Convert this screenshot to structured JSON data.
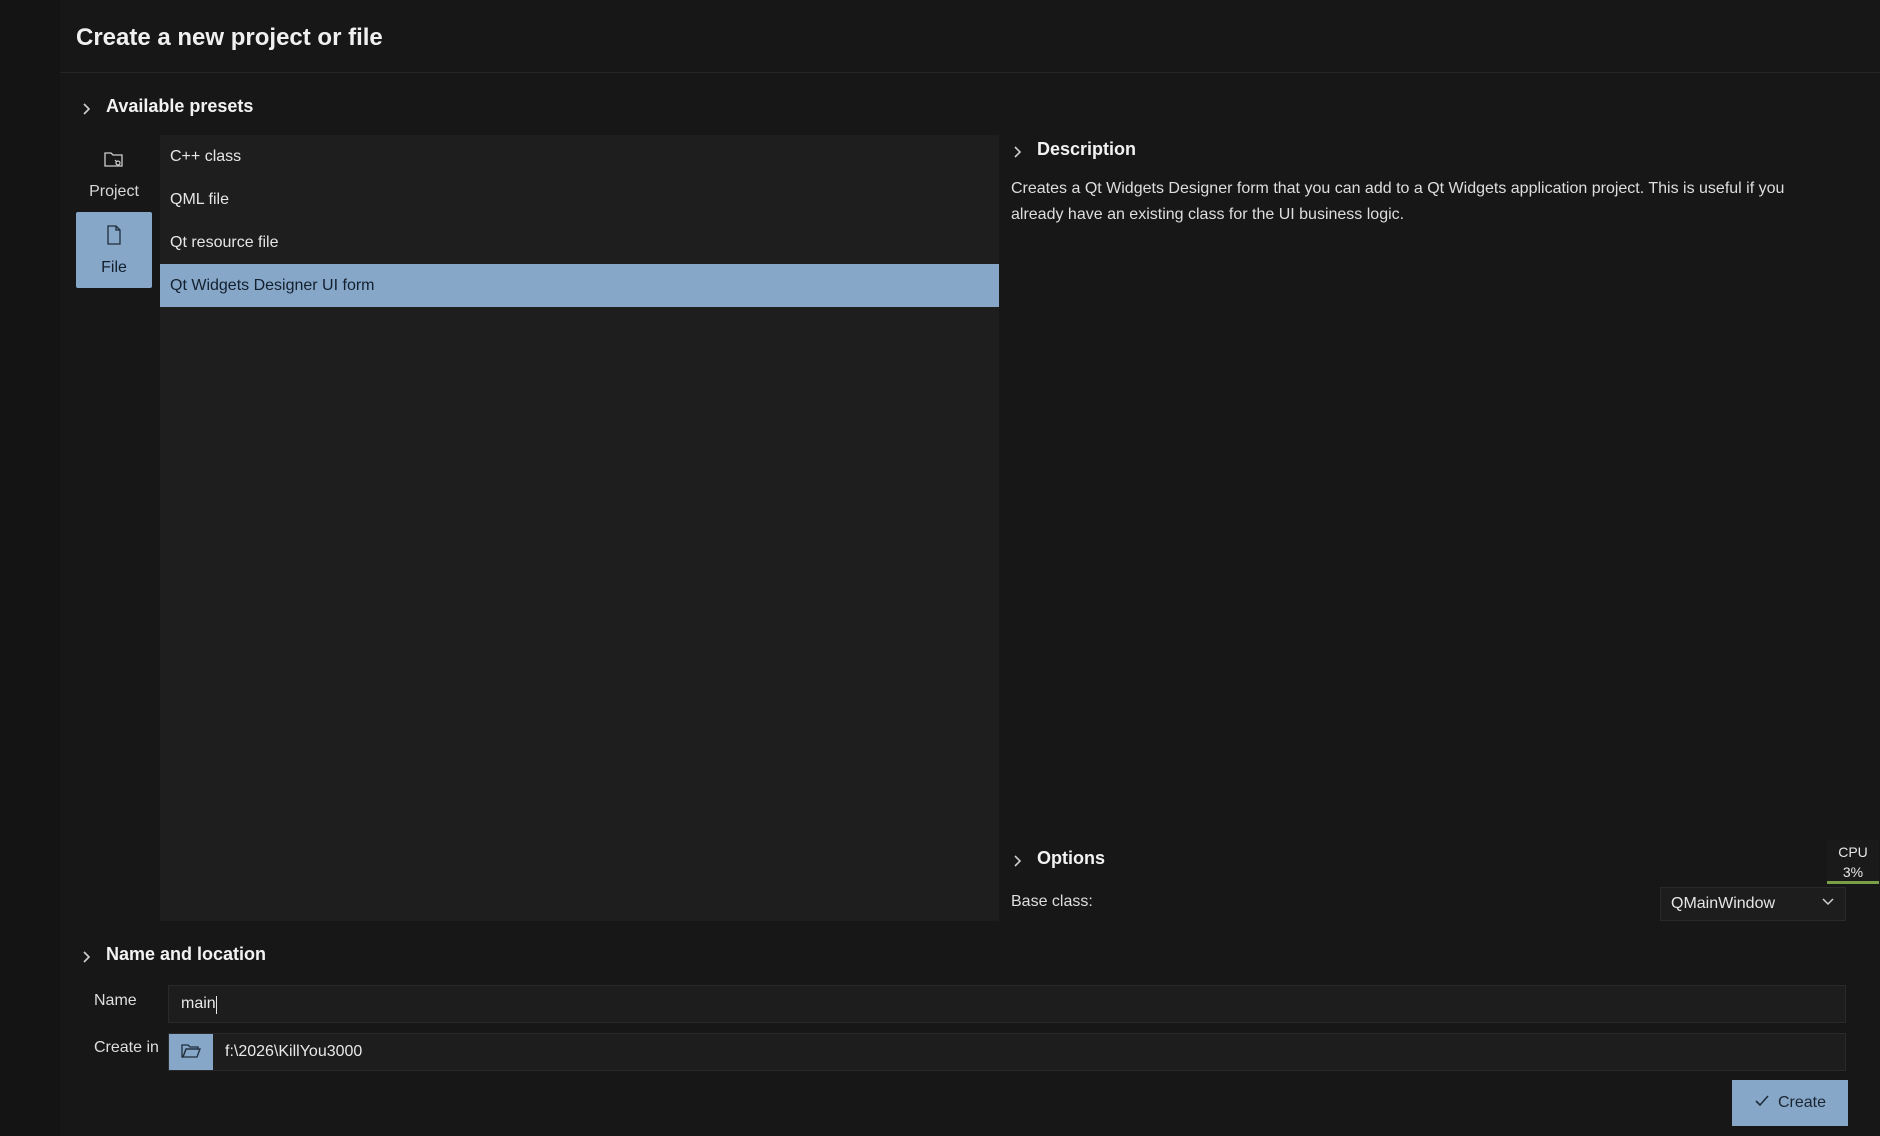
{
  "dialog": {
    "title": "Create a new project or file"
  },
  "presets": {
    "header": "Available presets",
    "categories": [
      {
        "label": "Project",
        "icon": "folder-project-icon",
        "selected": false
      },
      {
        "label": "File",
        "icon": "file-icon",
        "selected": true
      }
    ],
    "items": [
      {
        "label": "C++ class",
        "selected": false
      },
      {
        "label": "QML file",
        "selected": false
      },
      {
        "label": "Qt resource file",
        "selected": false
      },
      {
        "label": "Qt Widgets Designer UI form",
        "selected": true
      }
    ]
  },
  "description": {
    "header": "Description",
    "text": "Creates a Qt Widgets Designer form that you can add to a Qt Widgets application project. This is useful if you already have an existing class for the UI business logic."
  },
  "options": {
    "header": "Options",
    "base_class_label": "Base class:",
    "base_class_value": "QMainWindow"
  },
  "name_location": {
    "header": "Name and location",
    "name_label": "Name",
    "name_value": "main",
    "create_in_label": "Create in",
    "create_in_value": "f:\\2026\\KillYou3000"
  },
  "footer": {
    "create_label": "Create"
  },
  "cpu_indicator": {
    "label": "CPU",
    "value": "3%"
  },
  "colors": {
    "accent": "#87a7c9",
    "background": "#171717",
    "panel": "#1e1e1e",
    "cpu_bar": "#7aa047"
  }
}
